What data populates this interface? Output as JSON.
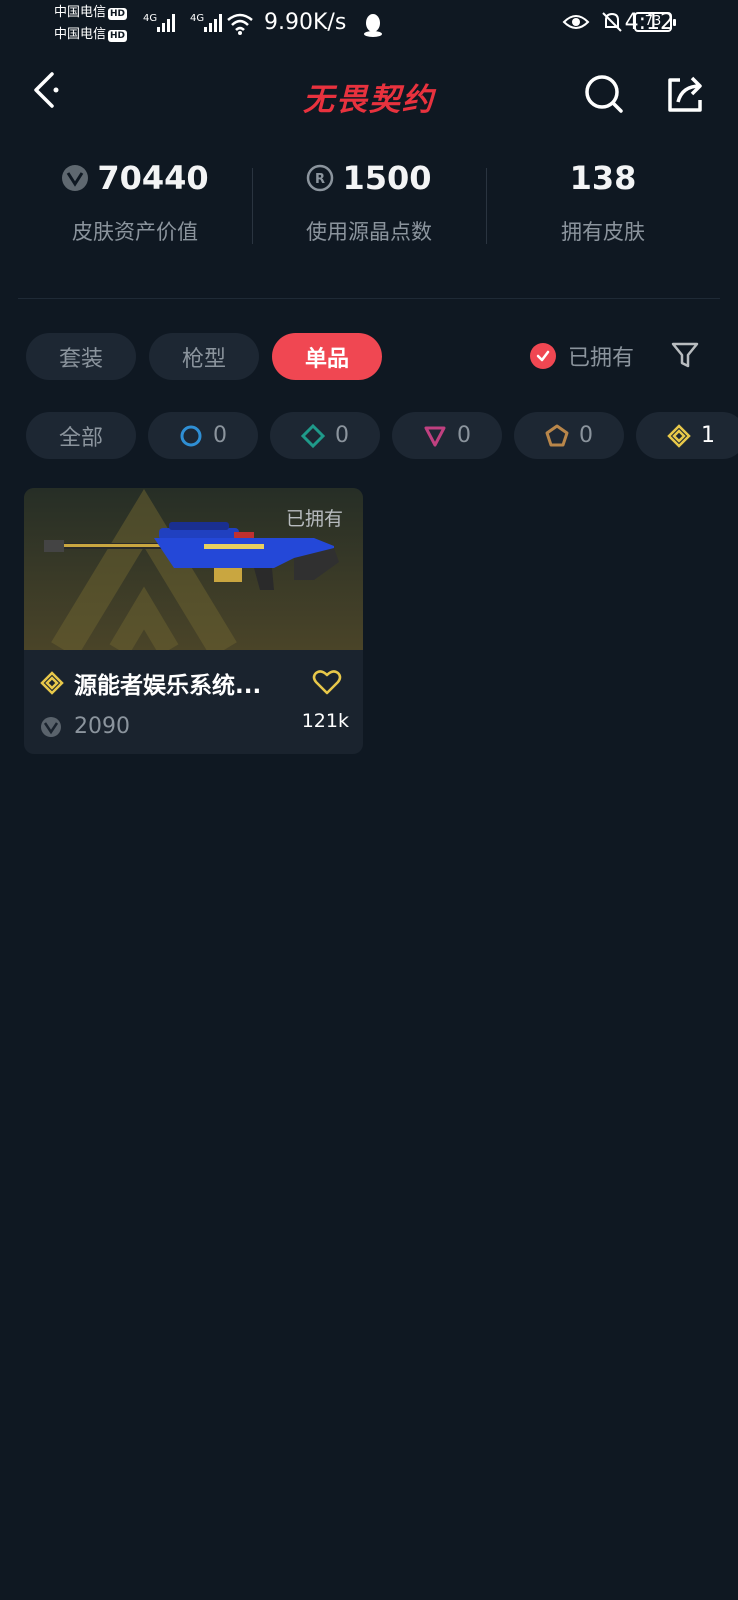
{
  "status_bar": {
    "carrier1": "中国电信",
    "carrier2": "中国电信",
    "hd": "HD",
    "network": "4G",
    "net_speed": "9.90K/s",
    "battery": "73",
    "time": "4:12"
  },
  "header": {
    "title": "无畏契约",
    "back_icon": "chevron-left-icon",
    "search_icon": "search-icon",
    "share_icon": "share-icon"
  },
  "stats": [
    {
      "value": "70440",
      "label": "皮肤资产价值",
      "icon": "vp-currency-icon"
    },
    {
      "value": "1500",
      "label": "使用源晶点数",
      "icon": "radianite-icon"
    },
    {
      "value": "138",
      "label": "拥有皮肤"
    }
  ],
  "tabs": [
    {
      "label": "套装"
    },
    {
      "label": "枪型"
    },
    {
      "label": "单品",
      "active": true
    }
  ],
  "owned_filter": {
    "label": "已拥有",
    "checked": true
  },
  "rarity_filters": [
    {
      "label": "全部"
    },
    {
      "count": "0",
      "icon": "select-tier-icon",
      "color": "#2f8fd4"
    },
    {
      "count": "0",
      "icon": "deluxe-tier-icon",
      "color": "#1f9a8a"
    },
    {
      "count": "0",
      "icon": "premium-tier-icon",
      "color": "#c04080"
    },
    {
      "count": "0",
      "icon": "exclusive-tier-icon",
      "color": "#b8864a"
    },
    {
      "count": "1",
      "icon": "ultra-tier-icon",
      "color": "#e8c84a"
    }
  ],
  "items": [
    {
      "owned_tag": "已拥有",
      "name": "源能者娱乐系统...",
      "price": "2090",
      "likes": "121k",
      "tier_color": "#e8c84a"
    }
  ],
  "colors": {
    "background": "#0f1822",
    "accent": "#f04752",
    "pill": "#1d2733"
  }
}
